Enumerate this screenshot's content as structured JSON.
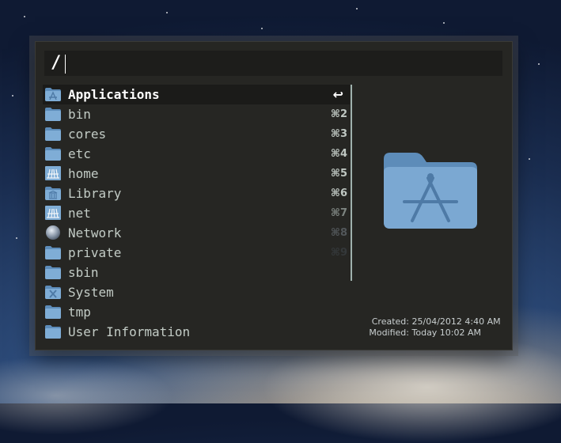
{
  "query": {
    "text": "/"
  },
  "results": [
    {
      "label": "Applications",
      "icon": "applications-folder-icon",
      "shortcut": "↩"
    },
    {
      "label": "bin",
      "icon": "folder-icon",
      "shortcut": "⌘2"
    },
    {
      "label": "cores",
      "icon": "folder-icon",
      "shortcut": "⌘3"
    },
    {
      "label": "etc",
      "icon": "folder-icon",
      "shortcut": "⌘4"
    },
    {
      "label": "home",
      "icon": "network-folder-icon",
      "shortcut": "⌘5"
    },
    {
      "label": "Library",
      "icon": "library-folder-icon",
      "shortcut": "⌘6"
    },
    {
      "label": "net",
      "icon": "network-folder-icon",
      "shortcut": "⌘7"
    },
    {
      "label": "Network",
      "icon": "network-globe-icon",
      "shortcut": "⌘8"
    },
    {
      "label": "private",
      "icon": "folder-icon",
      "shortcut": "⌘9"
    },
    {
      "label": "sbin",
      "icon": "folder-icon",
      "shortcut": ""
    },
    {
      "label": "System",
      "icon": "system-folder-icon",
      "shortcut": ""
    },
    {
      "label": "tmp",
      "icon": "folder-icon",
      "shortcut": ""
    },
    {
      "label": "User Information",
      "icon": "folder-icon",
      "shortcut": ""
    }
  ],
  "preview": {
    "icon": "applications-folder-icon",
    "created_label": "Created:",
    "created_value": "25/04/2012 4:40 AM",
    "modified_label": "Modified:",
    "modified_value": "Today 10:02 AM"
  },
  "colors": {
    "folder": "#6e9cc8",
    "accent": "#9fb1ad"
  }
}
